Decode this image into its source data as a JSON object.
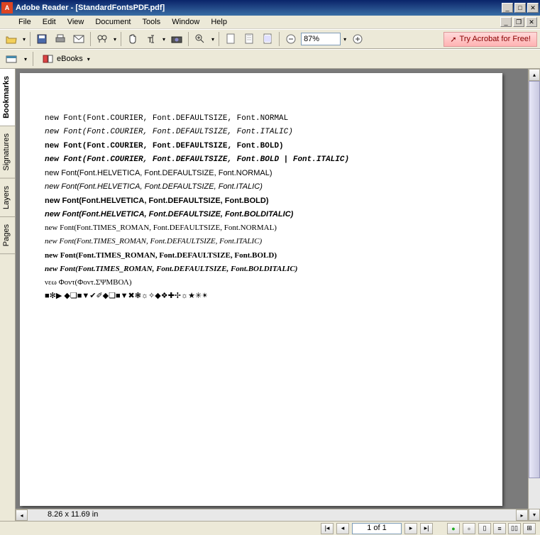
{
  "title": "Adobe Reader - [StandardFontsPDF.pdf]",
  "menu": {
    "file": "File",
    "edit": "Edit",
    "view": "View",
    "document": "Document",
    "tools": "Tools",
    "window": "Window",
    "help": "Help"
  },
  "toolbar": {
    "zoom_value": "87%",
    "acrobat": "Try Acrobat for Free!",
    "ebooks": "eBooks"
  },
  "sidetabs": {
    "bookmarks": "Bookmarks",
    "signatures": "Signatures",
    "layers": "Layers",
    "pages": "Pages"
  },
  "doc_lines": [
    {
      "text": "new Font(Font.COURIER, Font.DEFAULTSIZE, Font.NORMAL",
      "cls": "courier"
    },
    {
      "text": "new Font(Font.COURIER, Font.DEFAULTSIZE, Font.ITALIC)",
      "cls": "courier",
      "style": "font-style:italic"
    },
    {
      "text": "new Font(Font.COURIER, Font.DEFAULTSIZE, Font.BOLD)",
      "cls": "courier",
      "style": "font-weight:bold"
    },
    {
      "text": "new Font(Font.COURIER, Font.DEFAULTSIZE, Font.BOLD | Font.ITALIC)",
      "cls": "courier",
      "style": "font-weight:bold;font-style:italic"
    },
    {
      "text": "new Font(Font.HELVETICA, Font.DEFAULTSIZE, Font.NORMAL)",
      "cls": "helv"
    },
    {
      "text": "new Font(Font.HELVETICA, Font.DEFAULTSIZE, Font.ITALIC)",
      "cls": "helv",
      "style": "font-style:italic"
    },
    {
      "text": "new Font(Font.HELVETICA, Font.DEFAULTSIZE, Font.BOLD)",
      "cls": "helv",
      "style": "font-weight:bold"
    },
    {
      "text": "new Font(Font.HELVETICA, Font.DEFAULTSIZE, Font.BOLDITALIC)",
      "cls": "helv",
      "style": "font-weight:bold;font-style:italic"
    },
    {
      "text": "new Font(Font.TIMES_ROMAN, Font.DEFAULTSIZE, Font.NORMAL)",
      "cls": "times"
    },
    {
      "text": "new Font(Font.TIMES_ROMAN, Font.DEFAULTSIZE, Font.ITALIC)",
      "cls": "times",
      "style": "font-style:italic"
    },
    {
      "text": "new Font(Font.TIMES_ROMAN, Font.DEFAULTSIZE, Font.BOLD)",
      "cls": "times",
      "style": "font-weight:bold"
    },
    {
      "text": "new Font(Font.TIMES_ROMAN, Font.DEFAULTSIZE, Font.BOLDITALIC)",
      "cls": "times",
      "style": "font-weight:bold;font-style:italic"
    },
    {
      "text": "νεω Φοντ(Φοντ.ΣΨΜΒΟΛ)",
      "cls": "times"
    },
    {
      "text": "■✻▶ ◆❏■▼✔✐◆❏■▼✖❃☼✧◆❖✚✢☼★✳✴",
      "cls": ""
    }
  ],
  "page_dims": "8.26 x 11.69 in",
  "status": {
    "page": "1 of 1"
  }
}
